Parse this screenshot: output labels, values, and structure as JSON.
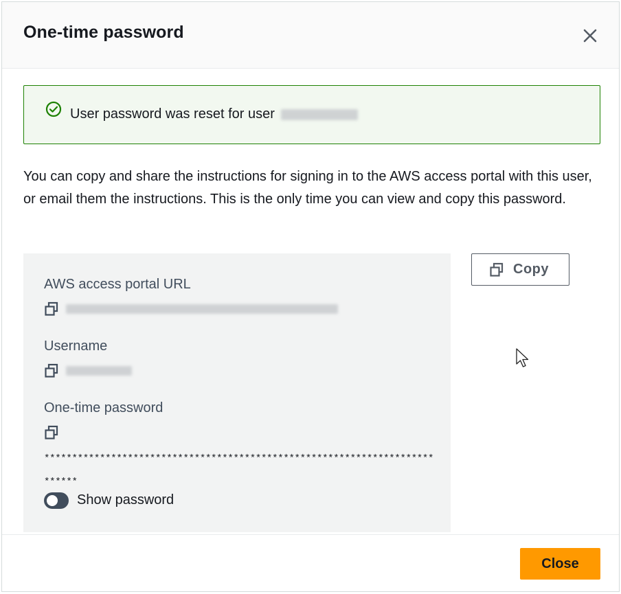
{
  "modal": {
    "title": "One-time password",
    "close_icon": "close-icon"
  },
  "alert": {
    "type": "success",
    "icon": "check-circle-icon",
    "message": "User password was reset for user"
  },
  "intro_text": "You can copy and share the instructions for signing in to the AWS access portal with this user, or email them the instructions. This is the only time you can view and copy this password.",
  "info": {
    "portal_url_label": "AWS access portal URL",
    "username_label": "Username",
    "password_label": "One-time password",
    "password_masked": "****************************************************************************",
    "show_password_label": "Show password",
    "show_password_enabled": false
  },
  "buttons": {
    "copy_label": "Copy",
    "close_label": "Close"
  },
  "colors": {
    "accent_primary": "#ff9900",
    "success_border": "#1d8102",
    "success_bg": "#f2f8f0",
    "info_bg": "#f2f3f3"
  }
}
